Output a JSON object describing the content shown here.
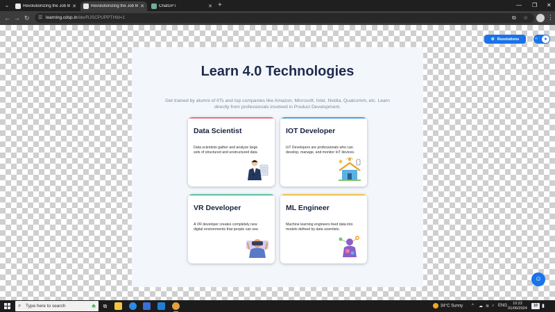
{
  "browser": {
    "tabs": [
      {
        "title": "Revolutionizing the Job Market",
        "active": false
      },
      {
        "title": "Revolutionizing the Job Market",
        "active": true
      },
      {
        "title": "ChatGPT",
        "active": false
      }
    ],
    "url_host": "learning.cdsp.in",
    "url_path": "/ide/RJSCPUPPTHId=1"
  },
  "toolbar": {
    "resolutions_label": "Resolutions"
  },
  "page": {
    "title": "Learn 4.0 Technologies",
    "subtitle": "Get trained by alumni of IITs and top companies like Amazon, Microsoft, Intel, Nvidia, Qualcomm, etc. Learn directly from professionals involved in Product Development.",
    "cards": [
      {
        "title": "Data Scientist",
        "description": "Data scientists gather and analyze large sets of structured and unstructured data",
        "accent": "#e8707e",
        "icon": "data-scientist-icon"
      },
      {
        "title": "IOT Developer",
        "description": "IoT Developers are professionals who can develop, manage, and monitor IoT devices.",
        "accent": "#4aa3df",
        "icon": "iot-home-icon"
      },
      {
        "title": "VR Developer",
        "description": "A VR developer creates completely new digital environments that people can see.",
        "accent": "#5cc2a0",
        "icon": "vr-headset-icon"
      },
      {
        "title": "ML Engineer",
        "description": "Machine learning engineers feed data into models defined by data scientists.",
        "accent": "#f0c04a",
        "icon": "ml-robot-icon"
      }
    ]
  },
  "taskbar": {
    "search_placeholder": "Type here to search",
    "weather": "34°C  Sunny",
    "language": "ENG",
    "time": "10:22",
    "date": "01/06/2024",
    "notifications": "10"
  },
  "colors": {
    "accent_blue": "#1a73e8",
    "title_navy": "#1f2b4d"
  }
}
